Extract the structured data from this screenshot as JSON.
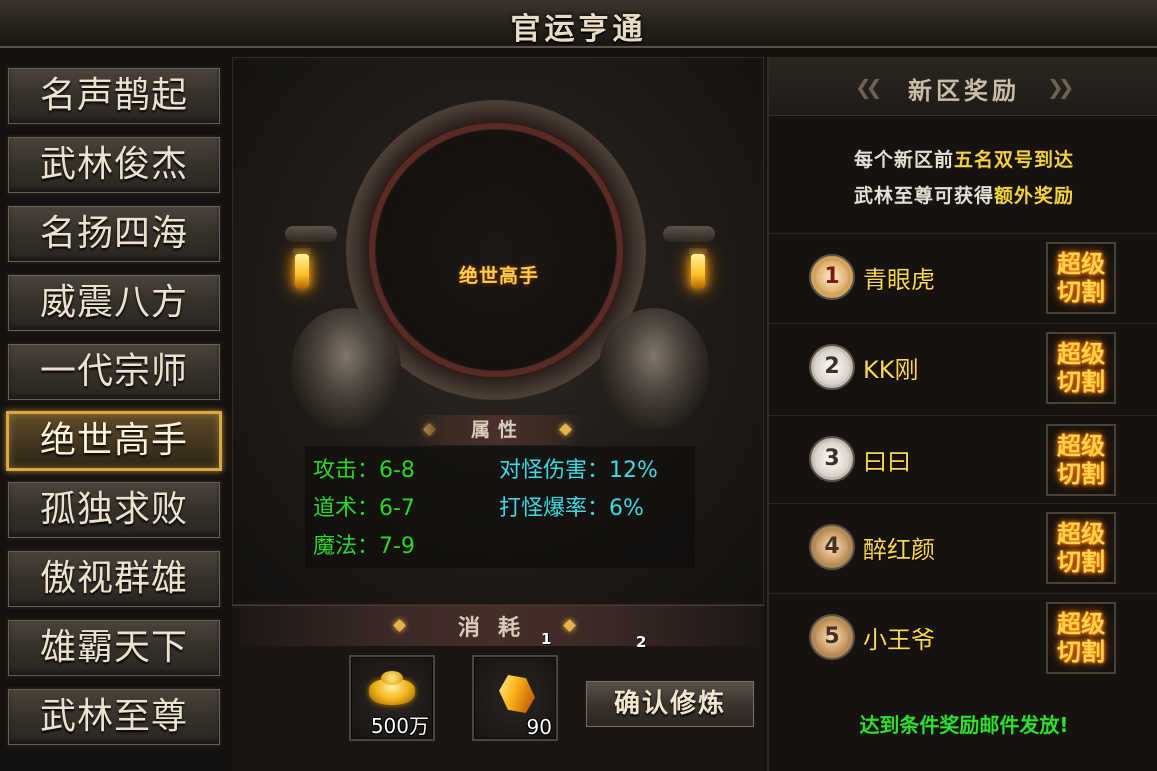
{
  "title": "官运亨通",
  "menu": [
    {
      "label": "名声鹊起",
      "active": false
    },
    {
      "label": "武林俊杰",
      "active": false
    },
    {
      "label": "名扬四海",
      "active": false
    },
    {
      "label": "威震八方",
      "active": false
    },
    {
      "label": "一代宗师",
      "active": false
    },
    {
      "label": "绝世高手",
      "active": true
    },
    {
      "label": "孤独求败",
      "active": false
    },
    {
      "label": "傲视群雄",
      "active": false
    },
    {
      "label": "雄霸天下",
      "active": false
    },
    {
      "label": "武林至尊",
      "active": false
    }
  ],
  "center": {
    "rank_title": "绝世高手",
    "attr_header": "属性",
    "stats": [
      {
        "label": "攻击：6-8",
        "color": "#2bd62b"
      },
      {
        "label": "对怪伤害：12%",
        "color": "#3fd8e6"
      },
      {
        "label": "道术：6-7",
        "color": "#2bd62b"
      },
      {
        "label": "打怪爆率：6%",
        "color": "#3fd8e6"
      },
      {
        "label": "魔法：7-9",
        "color": "#2bd62b"
      }
    ]
  },
  "cost": {
    "header": "消耗",
    "items": [
      {
        "icon": "gold-ingot-icon",
        "value": "500万"
      },
      {
        "icon": "gold-crystal-icon",
        "value": "90"
      }
    ],
    "markers": [
      "1",
      "2"
    ],
    "confirm_label": "确认修炼"
  },
  "rewards": {
    "header": "新区奖励",
    "desc_line1": [
      "每个新区前",
      "五名双号到达",
      ""
    ],
    "desc_line2": [
      "武林至尊可获得",
      "额外奖励",
      ""
    ],
    "ranks": [
      {
        "number": "1",
        "name": "青眼虎",
        "reward_line1": "超级",
        "reward_line2": "切割"
      },
      {
        "number": "2",
        "name": "KK刚",
        "reward_line1": "超级",
        "reward_line2": "切割"
      },
      {
        "number": "3",
        "name": "曰曰",
        "reward_line1": "超级",
        "reward_line2": "切割"
      },
      {
        "number": "4",
        "name": "醉红颜",
        "reward_line1": "超级",
        "reward_line2": "切割"
      },
      {
        "number": "5",
        "name": "小王爷",
        "reward_line1": "超级",
        "reward_line2": "切割"
      }
    ],
    "footer": "达到条件奖励邮件发放!"
  },
  "colors": {
    "accent_gold": "#d9aa44",
    "stat_green": "#2bd62b",
    "stat_cyan": "#3fd8e6",
    "player_yellow": "#ffd84a"
  }
}
